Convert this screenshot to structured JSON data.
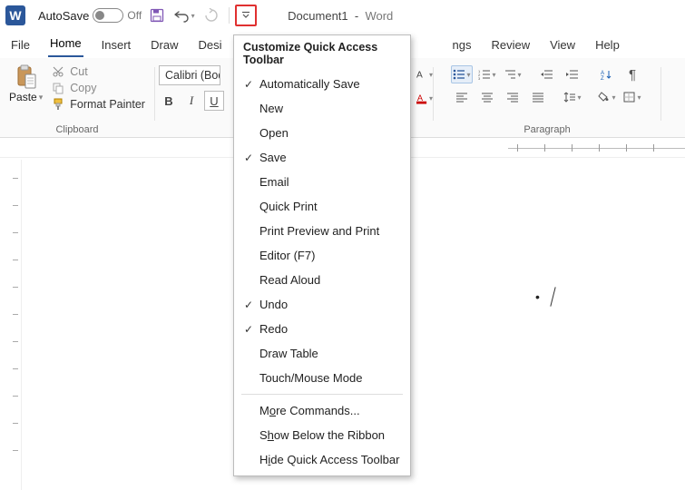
{
  "titlebar": {
    "app_letter": "W",
    "autosave_label": "AutoSave",
    "autosave_state": "Off",
    "doc_name": "Document1",
    "app_name": "Word"
  },
  "tabs": {
    "file": "File",
    "home": "Home",
    "insert": "Insert",
    "draw": "Draw",
    "design_partial": "Desi",
    "obscured_tail": "ngs",
    "review": "Review",
    "view": "View",
    "help": "Help"
  },
  "ribbon": {
    "paste": "Paste",
    "cut": "Cut",
    "copy": "Copy",
    "format_painter": "Format Painter",
    "clipboard_label": "Clipboard",
    "font_name": "Calibri (Bod",
    "bold": "B",
    "italic": "I",
    "underline": "U",
    "paragraph_label": "Paragraph",
    "pilcrow": "¶"
  },
  "menu": {
    "title": "Customize Quick Access Toolbar",
    "items": [
      {
        "label": "Automatically Save",
        "checked": true
      },
      {
        "label": "New",
        "checked": false
      },
      {
        "label": "Open",
        "checked": false
      },
      {
        "label": "Save",
        "checked": true
      },
      {
        "label": "Email",
        "checked": false
      },
      {
        "label": "Quick Print",
        "checked": false
      },
      {
        "label": "Print Preview and Print",
        "checked": false
      },
      {
        "label": "Editor (F7)",
        "checked": false
      },
      {
        "label": "Read Aloud",
        "checked": false
      },
      {
        "label": "Undo",
        "checked": true
      },
      {
        "label": "Redo",
        "checked": true
      },
      {
        "label": "Draw Table",
        "checked": false
      },
      {
        "label": "Touch/Mouse Mode",
        "checked": false
      }
    ],
    "more_pre": "M",
    "more_u": "o",
    "more_post": "re Commands...",
    "show_pre": "S",
    "show_u": "h",
    "show_post": "ow Below the Ribbon",
    "hide_pre": "H",
    "hide_u": "i",
    "hide_post": "de Quick Access Toolbar"
  }
}
